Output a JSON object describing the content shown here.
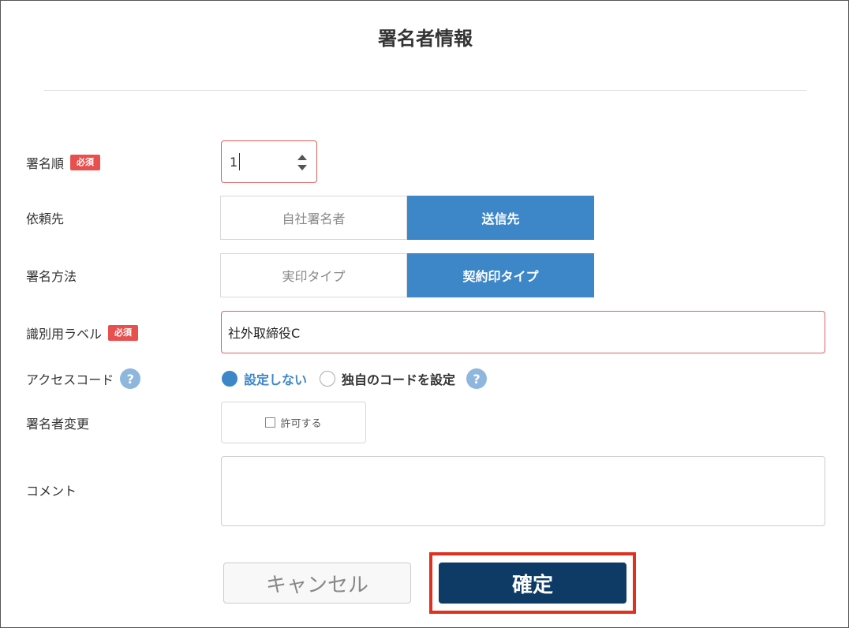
{
  "dialog": {
    "title": "署名者情報"
  },
  "required_badge": "必須",
  "rows": {
    "order": {
      "label": "署名順",
      "value": "1"
    },
    "recipient": {
      "label": "依頼先",
      "options": [
        "自社署名者",
        "送信先"
      ],
      "selected": "送信先"
    },
    "method": {
      "label": "署名方法",
      "options": [
        "実印タイプ",
        "契約印タイプ"
      ],
      "selected": "契約印タイプ"
    },
    "id_label": {
      "label": "識別用ラベル",
      "value": "社外取締役C"
    },
    "access_code": {
      "label": "アクセスコード",
      "options": [
        "設定しない",
        "独自のコードを設定"
      ],
      "selected": "設定しない",
      "help": "?"
    },
    "change_signer": {
      "label": "署名者変更",
      "checkbox_label": "許可する",
      "checked": false
    },
    "comment": {
      "label": "コメント",
      "value": ""
    }
  },
  "buttons": {
    "cancel": "キャンセル",
    "confirm": "確定"
  },
  "colors": {
    "accent": "#3d87c9",
    "required": "#e85050",
    "confirm": "#0e3a66",
    "highlight": "#e0301e"
  }
}
